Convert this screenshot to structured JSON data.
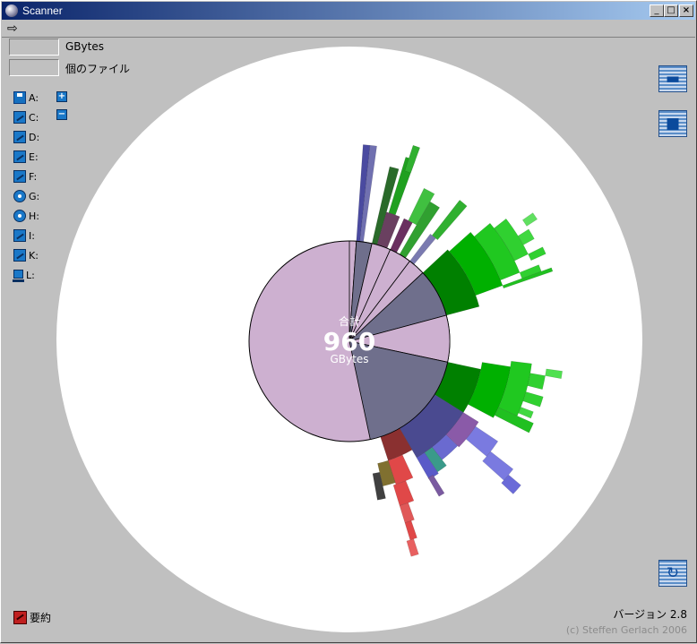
{
  "window": {
    "title": "Scanner"
  },
  "toolbar": {
    "back_icon": "arrow-right-icon"
  },
  "stats": {
    "size_value": "",
    "size_unit": "GBytes",
    "files_value": "",
    "files_unit": "個のファイル"
  },
  "drives": [
    {
      "label": "A:",
      "icon": "floppy-icon"
    },
    {
      "label": "C:",
      "icon": "hard-drive-icon"
    },
    {
      "label": "D:",
      "icon": "hard-drive-icon"
    },
    {
      "label": "E:",
      "icon": "hard-drive-icon"
    },
    {
      "label": "F:",
      "icon": "hard-drive-icon"
    },
    {
      "label": "G:",
      "icon": "cd-drive-icon"
    },
    {
      "label": "H:",
      "icon": "cd-drive-icon"
    },
    {
      "label": "I:",
      "icon": "hard-drive-icon"
    },
    {
      "label": "K:",
      "icon": "hard-drive-icon"
    },
    {
      "label": "L:",
      "icon": "network-drive-icon"
    }
  ],
  "controls": {
    "expand": "+",
    "collapse": "−"
  },
  "center": {
    "label": "合計",
    "value": "960",
    "unit": "GBytes"
  },
  "footer": {
    "summary_label": "要約",
    "version": "バージョン 2.8",
    "copyright": "(c) Steffen Gerlach 2006"
  },
  "colors": {
    "root": "#cdb0d0",
    "dir_dark": "#6f6f8c",
    "green": "#00c000",
    "green_dark": "#008000",
    "blue": "#5a5ad0",
    "red": "#e04848",
    "mauve": "#9a6aa8",
    "teal": "#3a9a8a"
  },
  "chart_data": {
    "type": "sunburst",
    "title": "",
    "total": 960,
    "unit": "GBytes",
    "rings": [
      {
        "level": 0,
        "segments": [
          {
            "share_pct": 100,
            "color": "#cdb0d0"
          }
        ]
      },
      {
        "level": 1,
        "segments": [
          {
            "start_deg": 0,
            "end_deg": 4,
            "color": "#cdb0d0"
          },
          {
            "start_deg": 4,
            "end_deg": 13,
            "color": "#6f6f8c"
          },
          {
            "start_deg": 13,
            "end_deg": 24,
            "color": "#cdb0d0"
          },
          {
            "start_deg": 24,
            "end_deg": 37,
            "color": "#cdb0d0"
          },
          {
            "start_deg": 37,
            "end_deg": 47,
            "color": "#cdb0d0"
          },
          {
            "start_deg": 47,
            "end_deg": 75,
            "color": "#6f6f8c"
          },
          {
            "start_deg": 75,
            "end_deg": 102,
            "color": "#cdb0d0"
          },
          {
            "start_deg": 102,
            "end_deg": 168,
            "color": "#6f6f8c"
          }
        ]
      }
    ]
  }
}
